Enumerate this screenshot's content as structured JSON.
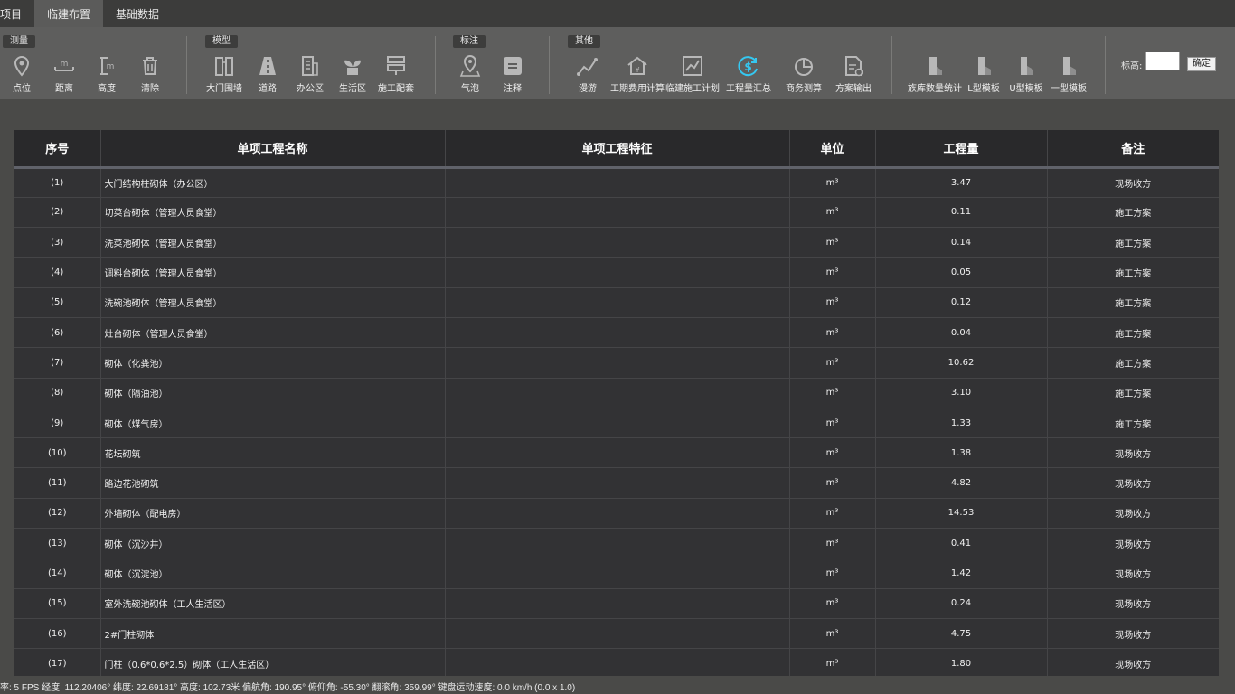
{
  "tabs": [
    {
      "label": "项目"
    },
    {
      "label": "临建布置"
    },
    {
      "label": "基础数据"
    }
  ],
  "groups": {
    "measure": "测量",
    "model": "模型",
    "annotate": "标注",
    "other": "其他"
  },
  "tools": {
    "point": "点位",
    "distance": "距离",
    "height": "高度",
    "clear": "清除",
    "gate_wall": "大门围墙",
    "road": "道路",
    "office": "办公区",
    "living": "生活区",
    "construction_kit": "施工配套",
    "bubble": "气泡",
    "note": "注释",
    "roam": "漫游",
    "schedule_cost": "工期费用计算",
    "temp_plan": "临建施工计划",
    "quantity_summary": "工程量汇总",
    "business_calc": "商务测算",
    "plan_output": "方案输出",
    "family_stats": "族库数量统计",
    "l_template": "L型模板",
    "u_template": "U型模板",
    "i_template": "一型模板"
  },
  "elevation": {
    "label": "标高:",
    "value": "",
    "ok_label": "确定"
  },
  "table": {
    "headers": [
      "序号",
      "单项工程名称",
      "单项工程特征",
      "单位",
      "工程量",
      "备注"
    ],
    "rows": [
      {
        "no": "(1)",
        "name": "大门结构柱砌体（办公区）",
        "feature": "",
        "unit": "m³",
        "qty": "3.47",
        "remark": "现场收方"
      },
      {
        "no": "(2)",
        "name": "切菜台砌体（管理人员食堂）",
        "feature": "",
        "unit": "m³",
        "qty": "0.11",
        "remark": "施工方案"
      },
      {
        "no": "(3)",
        "name": "洗菜池砌体（管理人员食堂）",
        "feature": "",
        "unit": "m³",
        "qty": "0.14",
        "remark": "施工方案"
      },
      {
        "no": "(4)",
        "name": "调料台砌体（管理人员食堂）",
        "feature": "",
        "unit": "m³",
        "qty": "0.05",
        "remark": "施工方案"
      },
      {
        "no": "(5)",
        "name": "洗碗池砌体（管理人员食堂）",
        "feature": "",
        "unit": "m³",
        "qty": "0.12",
        "remark": "施工方案"
      },
      {
        "no": "(6)",
        "name": "灶台砌体（管理人员食堂）",
        "feature": "",
        "unit": "m³",
        "qty": "0.04",
        "remark": "施工方案"
      },
      {
        "no": "(7)",
        "name": "砌体（化粪池）",
        "feature": "",
        "unit": "m³",
        "qty": "10.62",
        "remark": "施工方案"
      },
      {
        "no": "(8)",
        "name": "砌体（隔油池）",
        "feature": "",
        "unit": "m³",
        "qty": "3.10",
        "remark": "施工方案"
      },
      {
        "no": "(9)",
        "name": "砌体（煤气房）",
        "feature": "",
        "unit": "m³",
        "qty": "1.33",
        "remark": "施工方案"
      },
      {
        "no": "(10)",
        "name": "花坛砌筑",
        "feature": "",
        "unit": "m³",
        "qty": "1.38",
        "remark": "现场收方"
      },
      {
        "no": "(11)",
        "name": "路边花池砌筑",
        "feature": "",
        "unit": "m³",
        "qty": "4.82",
        "remark": "现场收方"
      },
      {
        "no": "(12)",
        "name": "外墙砌体（配电房）",
        "feature": "",
        "unit": "m³",
        "qty": "14.53",
        "remark": "现场收方"
      },
      {
        "no": "(13)",
        "name": "砌体（沉沙井）",
        "feature": "",
        "unit": "m³",
        "qty": "0.41",
        "remark": "现场收方"
      },
      {
        "no": "(14)",
        "name": "砌体（沉淀池）",
        "feature": "",
        "unit": "m³",
        "qty": "1.42",
        "remark": "现场收方"
      },
      {
        "no": "(15)",
        "name": "室外洗碗池砌体（工人生活区）",
        "feature": "",
        "unit": "m³",
        "qty": "0.24",
        "remark": "现场收方"
      },
      {
        "no": "(16)",
        "name": "2#门柱砌体",
        "feature": "",
        "unit": "m³",
        "qty": "4.75",
        "remark": "现场收方"
      },
      {
        "no": "(17)",
        "name": "门柱（0.6*0.6*2.5）砌体（工人生活区）",
        "feature": "",
        "unit": "m³",
        "qty": "1.80",
        "remark": "现场收方"
      }
    ]
  },
  "status_text": "率: 5 FPS 经度: 112.20406° 纬度: 22.69181° 高度: 102.73米 偏航角: 190.95° 俯仰角: -55.30° 翻滚角: 359.99° 键盘运动速度: 0.0 km/h (0.0 x 1.0)",
  "colors": {
    "accent": "#35c7f0",
    "ribbon_bg": "#5e5e5d",
    "table_header_bg": "#29292b",
    "table_row_bg": "#323234"
  }
}
